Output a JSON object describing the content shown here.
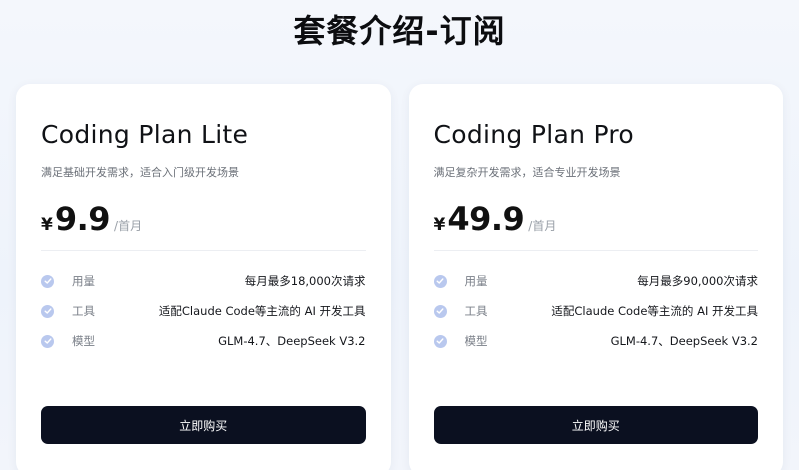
{
  "page": {
    "title": "套餐介绍-订阅"
  },
  "plans": [
    {
      "name": "Coding Plan Lite",
      "description": "满足基础开发需求，适合入门级开发场景",
      "currency": "¥",
      "price": "9.9",
      "period": "/首月",
      "features": [
        {
          "label": "用量",
          "value": "每月最多18,000次请求"
        },
        {
          "label": "工具",
          "value": "适配Claude Code等主流的 AI 开发工具"
        },
        {
          "label": "模型",
          "value": "GLM-4.7、DeepSeek V3.2"
        }
      ],
      "button_label": "立即购买"
    },
    {
      "name": "Coding Plan Pro",
      "description": "满足复杂开发需求，适合专业开发场景",
      "currency": "¥",
      "price": "49.9",
      "period": "/首月",
      "features": [
        {
          "label": "用量",
          "value": "每月最多90,000次请求"
        },
        {
          "label": "工具",
          "value": "适配Claude Code等主流的 AI 开发工具"
        },
        {
          "label": "模型",
          "value": "GLM-4.7、DeepSeek V3.2"
        }
      ],
      "button_label": "立即购买"
    }
  ],
  "colors": {
    "check_icon": "#b9c8ee",
    "button_bg": "#0b1020"
  },
  "icons": {
    "feature_check": "check-circle-icon"
  }
}
